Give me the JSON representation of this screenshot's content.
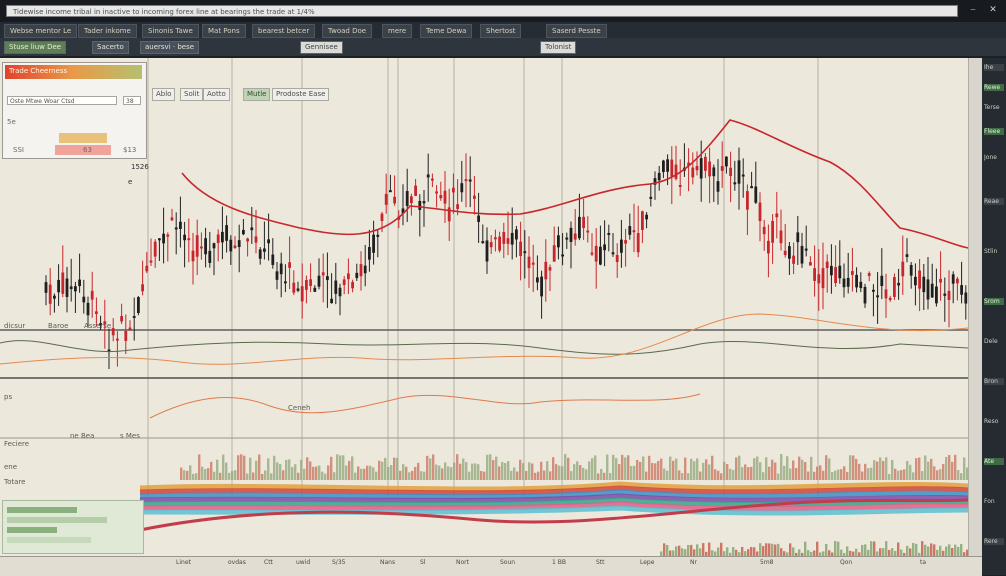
{
  "window": {
    "address_text": "Tidewise income tribal in inactive to incoming forex line at bearings the trade at 1/4%",
    "minimize": "⎯",
    "close": "✕"
  },
  "tabs": [
    "Webse mentor Le",
    "Tader inkome",
    "Sinonis Tawe",
    "Mat Pons",
    "bearest betcer",
    "Twoad Doe",
    "mere",
    "Teme Dewa",
    "Shertost",
    "Saserd Pesste"
  ],
  "toolbar": [
    "Stuse liuw Dee",
    "Sacerto",
    "auersvi · bese",
    "Gennisee",
    "Tolonist"
  ],
  "left_panel": {
    "header": "Trade Cheerness",
    "field1": "Oste Mtwe Woar Ctsd",
    "field2": "38",
    "row1": "5e",
    "row2": "SSI",
    "value1": "63",
    "value2": "$13",
    "value3": "1526",
    "value4": "e"
  },
  "top_chips": [
    "Ablo",
    "Solit",
    "Aotto",
    "Mutle",
    "Prodoste Ease"
  ],
  "markers": [
    "dicsur",
    "Baroe",
    "Asserse",
    "ps",
    "Feciere",
    "ne Bea",
    "s Mes",
    "Ceneh",
    "Totare",
    "ene"
  ],
  "x_axis": [
    "Linet",
    "ovdas",
    "Ctt",
    "uwid",
    "S/35",
    "Nans",
    "Sl",
    "Nort",
    "Soun",
    "1 BB",
    "Stt",
    "Lepe",
    "Nr",
    "5m8",
    "Qon",
    "ta"
  ],
  "right_panel": [
    "Ihe",
    "Rewe",
    "Terse",
    "Fleee",
    "Jone",
    "Reae",
    "Stlin",
    "Srom",
    "Dele",
    "Bron",
    "Reso",
    "Ate",
    "Fon",
    "Rere"
  ],
  "colors": {
    "background": "#ece8dc",
    "candle_up": "#1f1f1f",
    "candle_down": "#c8262c",
    "ma_line": "#c8262c",
    "accent_green": "#5d7e57"
  }
}
